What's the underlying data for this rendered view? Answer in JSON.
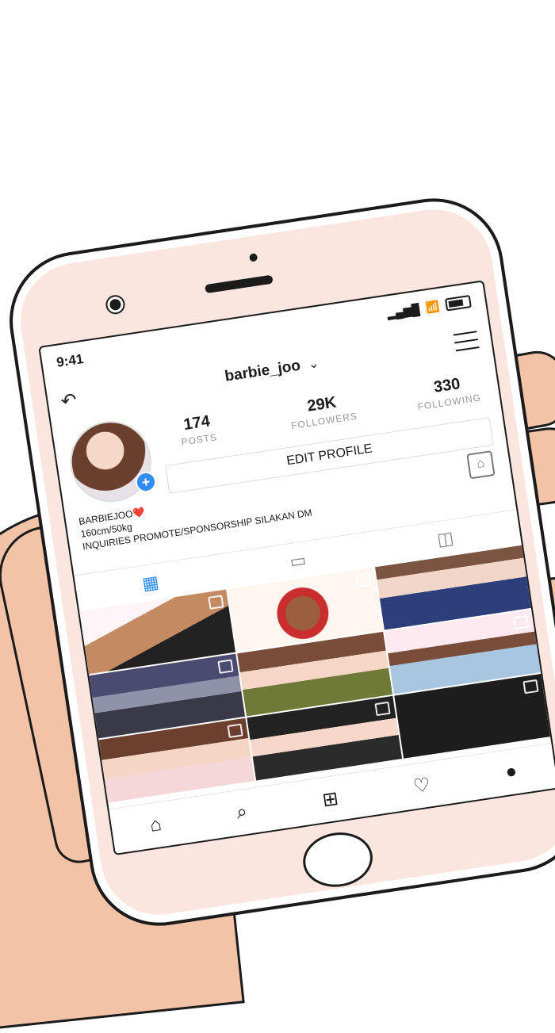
{
  "status": {
    "time": "9:41"
  },
  "profile": {
    "username": "barbie_joo",
    "stats": [
      {
        "count": "174",
        "label": "POSTS"
      },
      {
        "count": "29K",
        "label": "FOLLOWERS"
      },
      {
        "count": "330",
        "label": "FOLLOWING"
      }
    ],
    "edit_label": "EDIT PROFILE",
    "bio_lines": [
      "BARBIEJOO❤️",
      "160cm/50kg",
      "INQUIRIES PROMOTE/SPONSORSHIP SILAKAN DM"
    ]
  },
  "icons": {
    "history": "history-icon",
    "chevron": "chevron-down-icon",
    "menu": "menu-icon",
    "grid": "grid-icon",
    "list": "list-icon",
    "tagged": "tagged-icon",
    "home": "home-icon",
    "search": "search-icon",
    "add": "add-icon",
    "heart": "heart-icon",
    "profile": "profile-icon"
  },
  "colors": {
    "accent": "#2f8cff",
    "phone_frame": "#fbe6df"
  }
}
